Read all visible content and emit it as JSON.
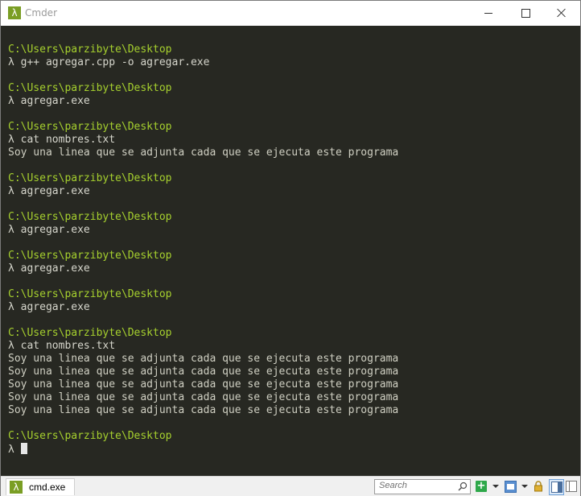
{
  "window": {
    "title": "Cmder",
    "app_icon_glyph": "λ"
  },
  "terminal": {
    "lines": [
      {
        "type": "path",
        "text": "C:\\Users\\parzibyte\\Desktop"
      },
      {
        "type": "cmd",
        "text": "λ g++ agregar.cpp -o agregar.exe"
      },
      {
        "type": "blank",
        "text": ""
      },
      {
        "type": "path",
        "text": "C:\\Users\\parzibyte\\Desktop"
      },
      {
        "type": "cmd",
        "text": "λ agregar.exe"
      },
      {
        "type": "blank",
        "text": ""
      },
      {
        "type": "path",
        "text": "C:\\Users\\parzibyte\\Desktop"
      },
      {
        "type": "cmd",
        "text": "λ cat nombres.txt"
      },
      {
        "type": "out",
        "text": "Soy una linea que se adjunta cada que se ejecuta este programa"
      },
      {
        "type": "blank",
        "text": ""
      },
      {
        "type": "path",
        "text": "C:\\Users\\parzibyte\\Desktop"
      },
      {
        "type": "cmd",
        "text": "λ agregar.exe"
      },
      {
        "type": "blank",
        "text": ""
      },
      {
        "type": "path",
        "text": "C:\\Users\\parzibyte\\Desktop"
      },
      {
        "type": "cmd",
        "text": "λ agregar.exe"
      },
      {
        "type": "blank",
        "text": ""
      },
      {
        "type": "path",
        "text": "C:\\Users\\parzibyte\\Desktop"
      },
      {
        "type": "cmd",
        "text": "λ agregar.exe"
      },
      {
        "type": "blank",
        "text": ""
      },
      {
        "type": "path",
        "text": "C:\\Users\\parzibyte\\Desktop"
      },
      {
        "type": "cmd",
        "text": "λ agregar.exe"
      },
      {
        "type": "blank",
        "text": ""
      },
      {
        "type": "path",
        "text": "C:\\Users\\parzibyte\\Desktop"
      },
      {
        "type": "cmd",
        "text": "λ cat nombres.txt"
      },
      {
        "type": "out",
        "text": "Soy una linea que se adjunta cada que se ejecuta este programa"
      },
      {
        "type": "out",
        "text": "Soy una linea que se adjunta cada que se ejecuta este programa"
      },
      {
        "type": "out",
        "text": "Soy una linea que se adjunta cada que se ejecuta este programa"
      },
      {
        "type": "out",
        "text": "Soy una linea que se adjunta cada que se ejecuta este programa"
      },
      {
        "type": "out",
        "text": "Soy una linea que se adjunta cada que se ejecuta este programa"
      },
      {
        "type": "blank",
        "text": ""
      },
      {
        "type": "path",
        "text": "C:\\Users\\parzibyte\\Desktop"
      }
    ],
    "prompt": "λ",
    "colors": {
      "background": "#272822",
      "path": "#a6d02e",
      "text": "#cfcfc2"
    }
  },
  "statusbar": {
    "tab_label": "cmd.exe",
    "tab_icon_glyph": "λ",
    "search_placeholder": "Search",
    "new_console_glyph": "+"
  }
}
